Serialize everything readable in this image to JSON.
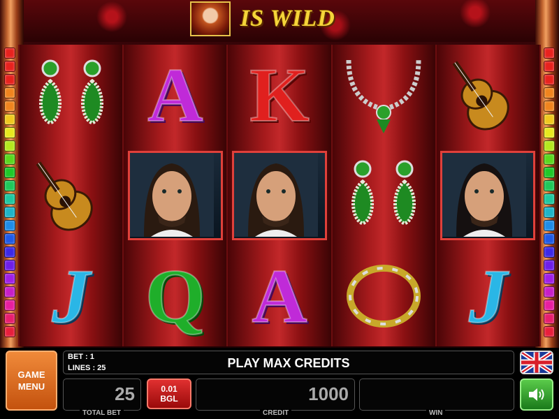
{
  "header": {
    "wild_text": "IS WILD"
  },
  "line_colors": [
    "#e8221e",
    "#e8221e",
    "#e8221e",
    "#f0841e",
    "#f0841e",
    "#f0c81e",
    "#e8e81e",
    "#b4e81e",
    "#5ad81e",
    "#1ec828",
    "#1ec85a",
    "#1ec8a0",
    "#1eb4c8",
    "#1e8ce8",
    "#1e5ae8",
    "#3c28e8",
    "#6e1ee8",
    "#a01ee8",
    "#c81ec8",
    "#e81ea0",
    "#e81e6e",
    "#e81e3c"
  ],
  "reels": [
    [
      "earrings",
      "guitar",
      "J"
    ],
    [
      "A",
      "man-portrait",
      "Q"
    ],
    [
      "K",
      "man-portrait",
      "A"
    ],
    [
      "necklace",
      "earrings",
      "tambourine"
    ],
    [
      "guitar",
      "matador-portrait",
      "J"
    ]
  ],
  "panel": {
    "menu_line1": "GAME",
    "menu_line2": "MENU",
    "bet": "BET : 1",
    "lines": "LINES : 25",
    "message": "PLAY MAX CREDITS",
    "total_bet_value": "25",
    "total_bet_label": "TOTAL BET",
    "denom_line1": "0.01",
    "denom_line2": "BGL",
    "credit_value": "1000",
    "credit_label": "CREDIT",
    "win_value": "",
    "win_label": "WIN"
  }
}
